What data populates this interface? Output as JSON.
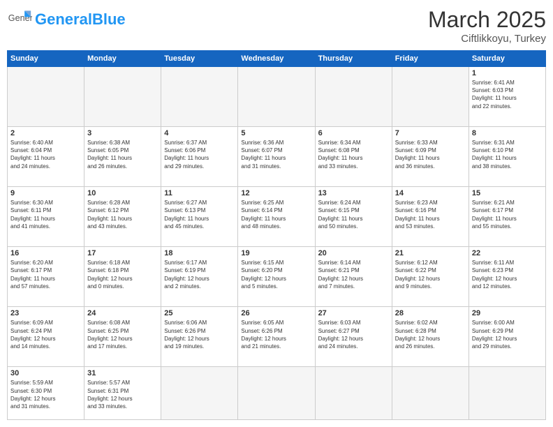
{
  "header": {
    "logo_general": "General",
    "logo_blue": "Blue",
    "title": "March 2025",
    "subtitle": "Ciftlikkoyu, Turkey"
  },
  "weekdays": [
    "Sunday",
    "Monday",
    "Tuesday",
    "Wednesday",
    "Thursday",
    "Friday",
    "Saturday"
  ],
  "weeks": [
    [
      {
        "day": "",
        "info": ""
      },
      {
        "day": "",
        "info": ""
      },
      {
        "day": "",
        "info": ""
      },
      {
        "day": "",
        "info": ""
      },
      {
        "day": "",
        "info": ""
      },
      {
        "day": "",
        "info": ""
      },
      {
        "day": "1",
        "info": "Sunrise: 6:41 AM\nSunset: 6:03 PM\nDaylight: 11 hours\nand 22 minutes."
      }
    ],
    [
      {
        "day": "2",
        "info": "Sunrise: 6:40 AM\nSunset: 6:04 PM\nDaylight: 11 hours\nand 24 minutes."
      },
      {
        "day": "3",
        "info": "Sunrise: 6:38 AM\nSunset: 6:05 PM\nDaylight: 11 hours\nand 26 minutes."
      },
      {
        "day": "4",
        "info": "Sunrise: 6:37 AM\nSunset: 6:06 PM\nDaylight: 11 hours\nand 29 minutes."
      },
      {
        "day": "5",
        "info": "Sunrise: 6:36 AM\nSunset: 6:07 PM\nDaylight: 11 hours\nand 31 minutes."
      },
      {
        "day": "6",
        "info": "Sunrise: 6:34 AM\nSunset: 6:08 PM\nDaylight: 11 hours\nand 33 minutes."
      },
      {
        "day": "7",
        "info": "Sunrise: 6:33 AM\nSunset: 6:09 PM\nDaylight: 11 hours\nand 36 minutes."
      },
      {
        "day": "8",
        "info": "Sunrise: 6:31 AM\nSunset: 6:10 PM\nDaylight: 11 hours\nand 38 minutes."
      }
    ],
    [
      {
        "day": "9",
        "info": "Sunrise: 6:30 AM\nSunset: 6:11 PM\nDaylight: 11 hours\nand 41 minutes."
      },
      {
        "day": "10",
        "info": "Sunrise: 6:28 AM\nSunset: 6:12 PM\nDaylight: 11 hours\nand 43 minutes."
      },
      {
        "day": "11",
        "info": "Sunrise: 6:27 AM\nSunset: 6:13 PM\nDaylight: 11 hours\nand 45 minutes."
      },
      {
        "day": "12",
        "info": "Sunrise: 6:25 AM\nSunset: 6:14 PM\nDaylight: 11 hours\nand 48 minutes."
      },
      {
        "day": "13",
        "info": "Sunrise: 6:24 AM\nSunset: 6:15 PM\nDaylight: 11 hours\nand 50 minutes."
      },
      {
        "day": "14",
        "info": "Sunrise: 6:23 AM\nSunset: 6:16 PM\nDaylight: 11 hours\nand 53 minutes."
      },
      {
        "day": "15",
        "info": "Sunrise: 6:21 AM\nSunset: 6:17 PM\nDaylight: 11 hours\nand 55 minutes."
      }
    ],
    [
      {
        "day": "16",
        "info": "Sunrise: 6:20 AM\nSunset: 6:17 PM\nDaylight: 11 hours\nand 57 minutes."
      },
      {
        "day": "17",
        "info": "Sunrise: 6:18 AM\nSunset: 6:18 PM\nDaylight: 12 hours\nand 0 minutes."
      },
      {
        "day": "18",
        "info": "Sunrise: 6:17 AM\nSunset: 6:19 PM\nDaylight: 12 hours\nand 2 minutes."
      },
      {
        "day": "19",
        "info": "Sunrise: 6:15 AM\nSunset: 6:20 PM\nDaylight: 12 hours\nand 5 minutes."
      },
      {
        "day": "20",
        "info": "Sunrise: 6:14 AM\nSunset: 6:21 PM\nDaylight: 12 hours\nand 7 minutes."
      },
      {
        "day": "21",
        "info": "Sunrise: 6:12 AM\nSunset: 6:22 PM\nDaylight: 12 hours\nand 9 minutes."
      },
      {
        "day": "22",
        "info": "Sunrise: 6:11 AM\nSunset: 6:23 PM\nDaylight: 12 hours\nand 12 minutes."
      }
    ],
    [
      {
        "day": "23",
        "info": "Sunrise: 6:09 AM\nSunset: 6:24 PM\nDaylight: 12 hours\nand 14 minutes."
      },
      {
        "day": "24",
        "info": "Sunrise: 6:08 AM\nSunset: 6:25 PM\nDaylight: 12 hours\nand 17 minutes."
      },
      {
        "day": "25",
        "info": "Sunrise: 6:06 AM\nSunset: 6:26 PM\nDaylight: 12 hours\nand 19 minutes."
      },
      {
        "day": "26",
        "info": "Sunrise: 6:05 AM\nSunset: 6:26 PM\nDaylight: 12 hours\nand 21 minutes."
      },
      {
        "day": "27",
        "info": "Sunrise: 6:03 AM\nSunset: 6:27 PM\nDaylight: 12 hours\nand 24 minutes."
      },
      {
        "day": "28",
        "info": "Sunrise: 6:02 AM\nSunset: 6:28 PM\nDaylight: 12 hours\nand 26 minutes."
      },
      {
        "day": "29",
        "info": "Sunrise: 6:00 AM\nSunset: 6:29 PM\nDaylight: 12 hours\nand 29 minutes."
      }
    ],
    [
      {
        "day": "30",
        "info": "Sunrise: 5:59 AM\nSunset: 6:30 PM\nDaylight: 12 hours\nand 31 minutes."
      },
      {
        "day": "31",
        "info": "Sunrise: 5:57 AM\nSunset: 6:31 PM\nDaylight: 12 hours\nand 33 minutes."
      },
      {
        "day": "",
        "info": ""
      },
      {
        "day": "",
        "info": ""
      },
      {
        "day": "",
        "info": ""
      },
      {
        "day": "",
        "info": ""
      },
      {
        "day": "",
        "info": ""
      }
    ]
  ]
}
